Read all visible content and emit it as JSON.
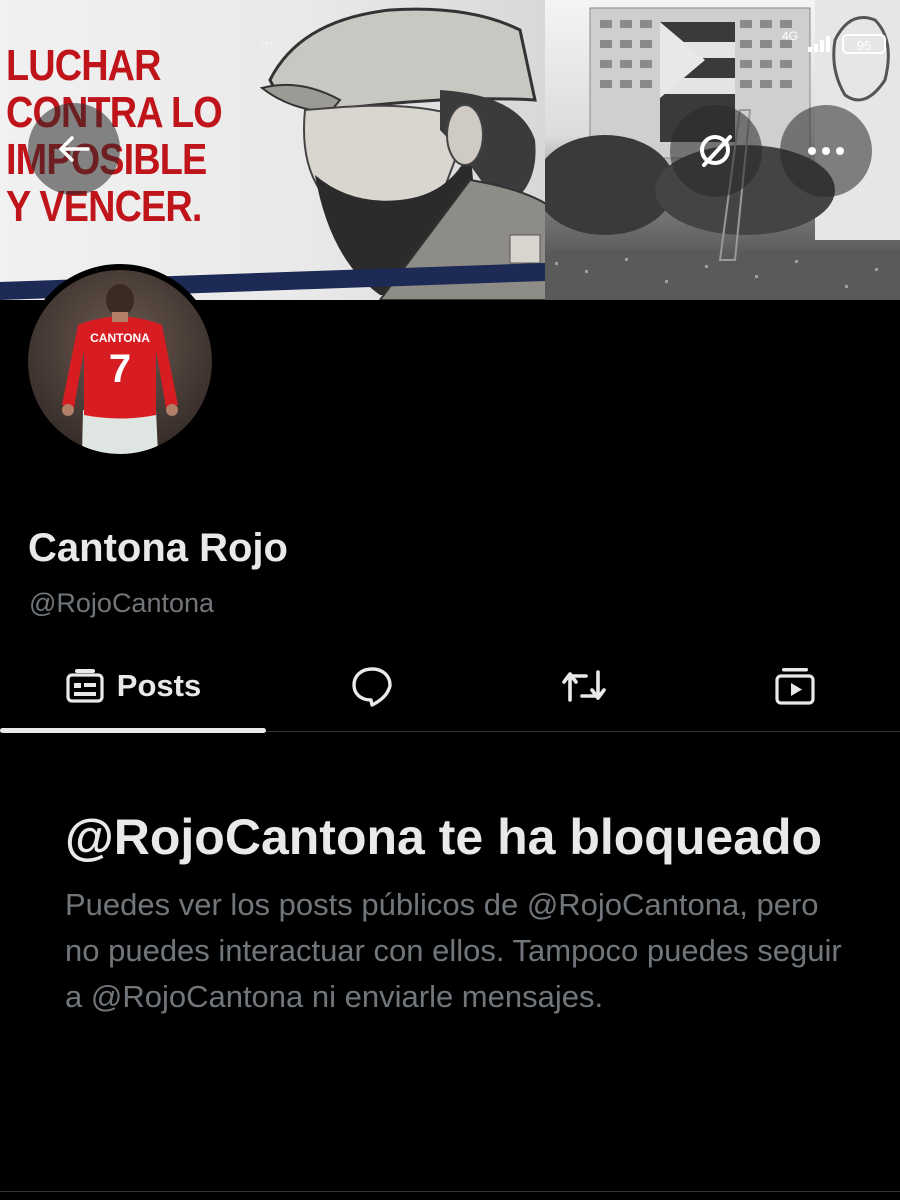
{
  "status_bar": {
    "network": "4G",
    "battery": "95",
    "overflow": "···"
  },
  "banner": {
    "poster_slogan": "LUCHAR\nCONTRA LO\nIMPOSIBLE\nY VENCER.",
    "jersey_name": "CANTONA",
    "jersey_number": "7"
  },
  "header": {
    "back_icon": "arrow-left-icon",
    "search_icon": "search-off-icon",
    "more_icon": "more-horizontal-icon"
  },
  "profile": {
    "name": "Cantona Rojo",
    "handle": "@RojoCantona"
  },
  "tabs": [
    {
      "icon": "posts-icon",
      "label": "Posts",
      "active": true
    },
    {
      "icon": "reply-bubble-icon",
      "label": "",
      "active": false
    },
    {
      "icon": "repost-icon",
      "label": "",
      "active": false
    },
    {
      "icon": "media-icon",
      "label": "",
      "active": false
    }
  ],
  "blocked": {
    "title": "@RojoCantona te ha bloqueado",
    "body": "Puedes ver los posts públicos de @RojoCantona, pero no puedes interactuar con ellos. Tampoco puedes seguir a @RojoCantona ni enviarle mensajes."
  },
  "colors": {
    "background": "#000000",
    "text_primary": "#e7e9ea",
    "text_secondary": "#71767b",
    "divider": "#2f3336",
    "slogan_red": "#c0141b"
  }
}
